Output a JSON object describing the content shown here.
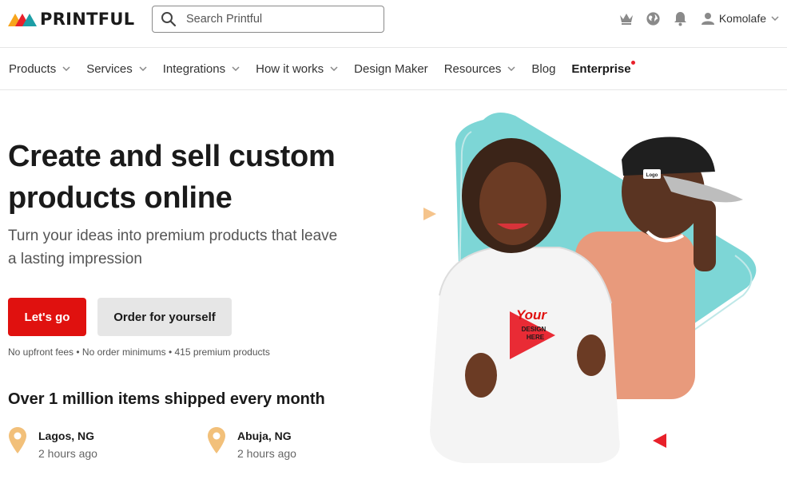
{
  "header": {
    "logo_text": "PRINTFUL",
    "search_placeholder": "Search Printful",
    "user_name": "Komolafe",
    "icons": [
      "crown-icon",
      "globe-icon",
      "bell-icon",
      "user-icon"
    ]
  },
  "nav": {
    "items": [
      {
        "label": "Products",
        "dropdown": true
      },
      {
        "label": "Services",
        "dropdown": true
      },
      {
        "label": "Integrations",
        "dropdown": true
      },
      {
        "label": "How it works",
        "dropdown": true
      },
      {
        "label": "Design Maker",
        "dropdown": false
      },
      {
        "label": "Resources",
        "dropdown": true
      },
      {
        "label": "Blog",
        "dropdown": false
      },
      {
        "label": "Enterprise",
        "dropdown": false
      }
    ]
  },
  "hero": {
    "title": "Create and sell custom products online",
    "subtitle": "Turn your ideas into premium products that leave a lasting impression",
    "primary_cta": "Let's go",
    "secondary_cta": "Order for yourself",
    "fine_print": "No upfront fees • No order minimums • 415 premium products",
    "shipped_heading": "Over 1 million items shipped every month",
    "locations": [
      {
        "city": "Lagos, NG",
        "time": "2 hours ago"
      },
      {
        "city": "Abuja, NG",
        "time": "2 hours ago"
      }
    ],
    "hoodie_print": {
      "line1": "Your",
      "line2": "DESIGN",
      "line3": "HERE"
    },
    "cap_logo": "Logo"
  },
  "colors": {
    "brand_red": "#e0110f",
    "teal": "#7dd6d6",
    "pin_orange": "#f2c07a",
    "text_dark": "#1a1a1a"
  }
}
